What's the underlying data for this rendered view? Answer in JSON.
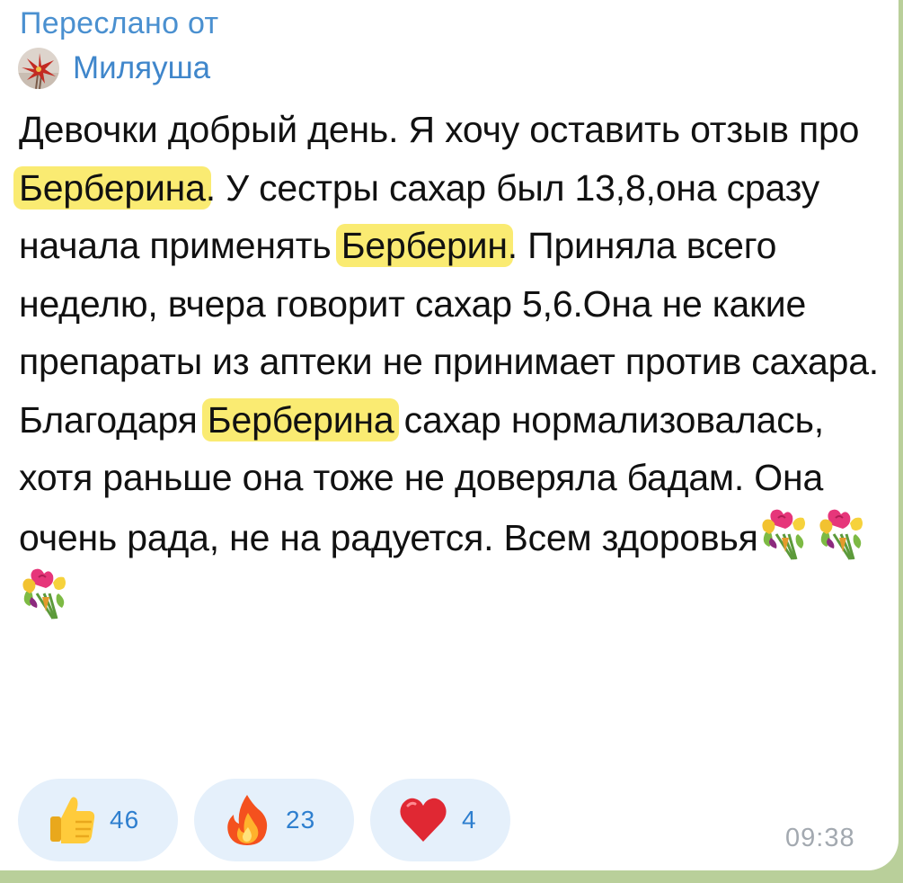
{
  "forwarded": {
    "label": "Переслано от",
    "sender_name": "Миляуша",
    "avatar_icon": "flower-avatar"
  },
  "message": {
    "segments": [
      "Девочки добрый день. Я хочу оставить отзыв про ",
      "Берберина",
      ". У сестры сахар был 13,8,она сразу начала применять ",
      "Берберин",
      ". Приняла всего неделю, вчера говорит сахар 5,6.Она не какие препараты из аптеки не принимает против сахара. Благодаря ",
      "Берберина",
      " сахар нормализовалась, хотя раньше она тоже не доверяла бадам. Она очень рада, не на радуется. Всем здоровья"
    ],
    "highlight_color": "#faeb72",
    "trailing_emoji": [
      "bouquet-icon",
      "bouquet-icon",
      "bouquet-icon"
    ]
  },
  "reactions": [
    {
      "icon": "thumbs-up-icon",
      "count": "46"
    },
    {
      "icon": "fire-icon",
      "count": "23"
    },
    {
      "icon": "heart-icon",
      "count": "4"
    }
  ],
  "timestamp": "09:38",
  "colors": {
    "link_blue": "#4a90d0",
    "reaction_bg": "#e5f0fb",
    "reaction_count": "#2e7fcf",
    "time_gray": "#a3a9b0",
    "chat_background": "#b9cf9a"
  }
}
